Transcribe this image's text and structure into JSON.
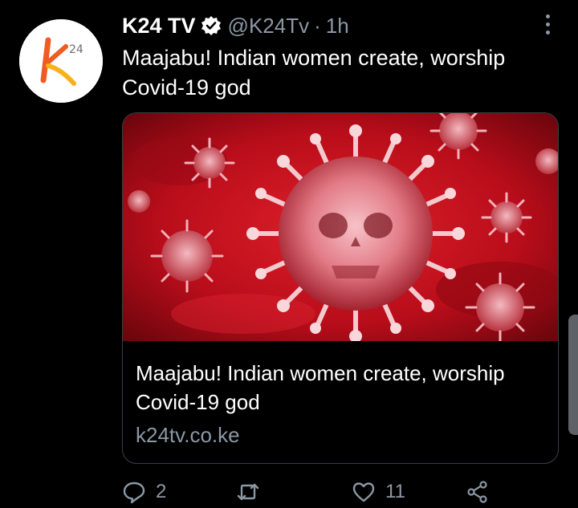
{
  "tweet": {
    "display_name": "K24 TV",
    "handle": "@K24Tv",
    "separator": "·",
    "time": "1h",
    "text": "Maajabu! Indian women create, worship Covid-19 god",
    "verified": true
  },
  "avatar": {
    "logo_text": "k",
    "logo_superscript": "24"
  },
  "card": {
    "title": "Maajabu! Indian women create, worship Covid-19 god",
    "domain": "k24tv.co.ke",
    "image_icon": "coronavirus-image"
  },
  "actions": {
    "reply_count": "2",
    "retweet_count": "",
    "like_count": "11"
  },
  "colors": {
    "background": "#000000",
    "text": "#ffffff",
    "secondary_text": "#8b98a5",
    "card_border": "#3a4047",
    "image_red": "#c8102e"
  }
}
